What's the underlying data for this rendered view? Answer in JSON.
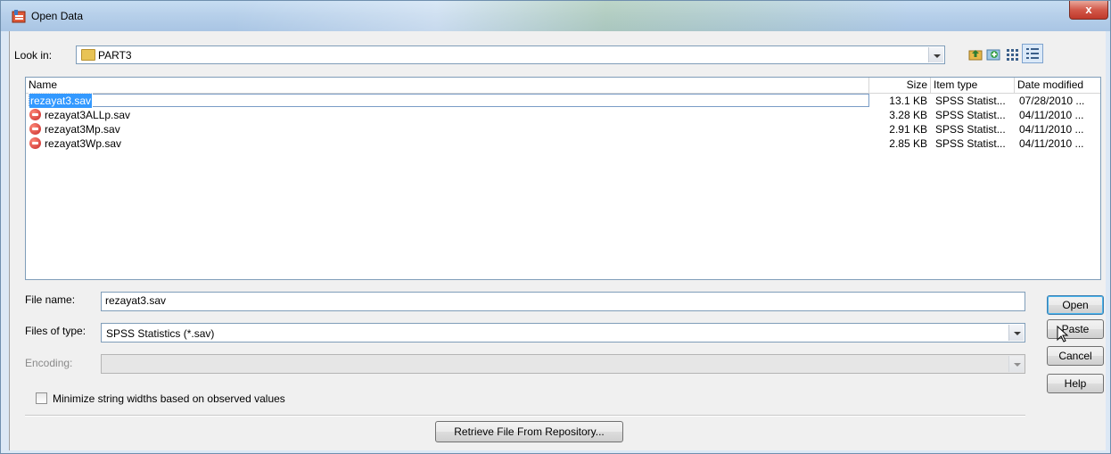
{
  "window": {
    "title": "Open Data",
    "close_glyph": "x"
  },
  "look_in": {
    "label": "Look in:",
    "value": "PART3"
  },
  "toolbar_icons": [
    "up-folder-icon",
    "new-folder-icon",
    "list-view-icon",
    "details-view-icon"
  ],
  "file_list": {
    "columns": {
      "name": "Name",
      "size": "Size",
      "type": "Item type",
      "date": "Date modified"
    },
    "rows": [
      {
        "name": "rezayat3.sav",
        "size": "13.1 KB",
        "type": "SPSS Statist...",
        "date": "07/28/2010 ...",
        "selected": true
      },
      {
        "name": "rezayat3ALLp.sav",
        "size": "3.28 KB",
        "type": "SPSS Statist...",
        "date": "04/11/2010 ..."
      },
      {
        "name": "rezayat3Mp.sav",
        "size": "2.91 KB",
        "type": "SPSS Statist...",
        "date": "04/11/2010 ..."
      },
      {
        "name": "rezayat3Wp.sav",
        "size": "2.85 KB",
        "type": "SPSS Statist...",
        "date": "04/11/2010 ..."
      }
    ]
  },
  "file_name": {
    "label": "File name:",
    "value": "rezayat3.sav"
  },
  "files_of_type": {
    "label": "Files of type:",
    "value": "SPSS Statistics (*.sav)"
  },
  "encoding": {
    "label": "Encoding:",
    "value": ""
  },
  "minimize_checkbox": {
    "label": "Minimize string widths based on observed values",
    "checked": false
  },
  "buttons": {
    "open": "Open",
    "paste": "Paste",
    "cancel": "Cancel",
    "help": "Help",
    "retrieve": "Retrieve File From Repository..."
  },
  "colors": {
    "title_bar": "#b7d0ea",
    "selection": "#3399ff",
    "close": "#c0392b"
  }
}
